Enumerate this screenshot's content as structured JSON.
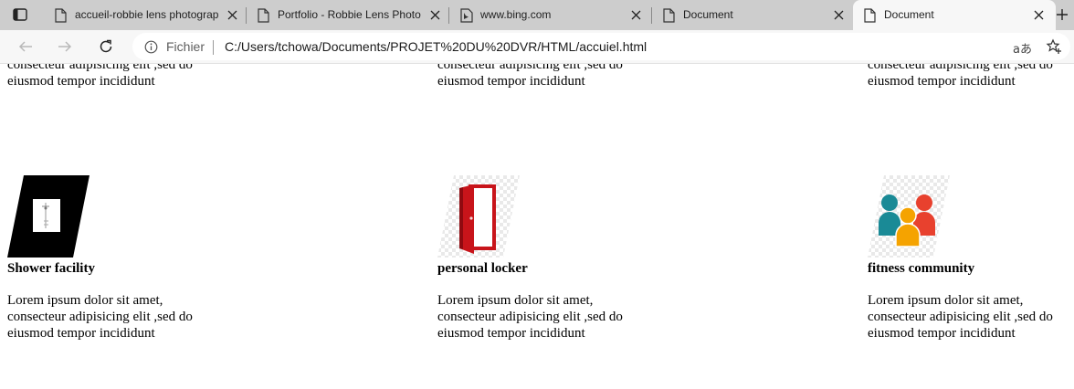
{
  "tabs": [
    {
      "title": "accueil-robbie lens photograp",
      "icon": "document-icon"
    },
    {
      "title": "Portfolio - Robbie Lens Photo",
      "icon": "document-icon"
    },
    {
      "title": "www.bing.com",
      "icon": "bing-icon"
    },
    {
      "title": "Document",
      "icon": "document-icon"
    },
    {
      "title": "Document",
      "icon": "document-icon",
      "active": true
    }
  ],
  "address_bar": {
    "site_label": "Fichier",
    "url": "C:/Users/tchowa/Documents/PROJET%20DU%20DVR/HTML/accuiel.html",
    "read_aloud_label": "aあ"
  },
  "top_fragment": {
    "line1": "consecteur adipisicing elit ,sed do",
    "line2": "eiusmod tempor incididunt"
  },
  "features": [
    {
      "title": "Shower facility",
      "icon": "shower-facility-icon",
      "line1": "Lorem ipsum dolor sit amet,",
      "line2": "consecteur adipisicing elit ,sed do",
      "line3": "eiusmod tempor incididunt"
    },
    {
      "title": "personal locker",
      "icon": "red-door-icon",
      "line1": "Lorem ipsum dolor sit amet,",
      "line2": "consecteur adipisicing elit ,sed do",
      "line3": "eiusmod tempor incididunt"
    },
    {
      "title": "fitness community",
      "icon": "community-people-icon",
      "line1": "Lorem ipsum dolor sit amet,",
      "line2": "consecteur adipisicing elit ,sed do",
      "line3": "eiusmod tempor incididunt"
    }
  ],
  "colors": {
    "tabstrip": "#cdcdcd",
    "toolbar": "#f7f7f7",
    "door_red": "#c8141a",
    "community_teal": "#1a8a96",
    "community_orange": "#f5a300",
    "community_red": "#e8412e"
  }
}
